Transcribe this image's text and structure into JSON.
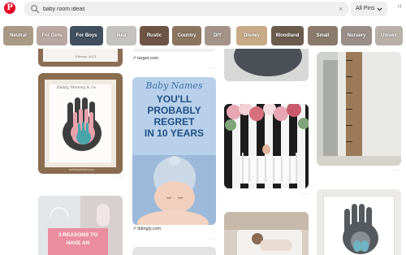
{
  "header": {
    "logo_letter": "P",
    "search_value": "baby room ideas",
    "search_placeholder": "Search",
    "clear_symbol": "×",
    "filter_label": "All Pins",
    "right_label": "H"
  },
  "guides": [
    {
      "label": "Neutral",
      "color": "#a99a86"
    },
    {
      "label": "For Girls",
      "color": "#b9a7a2"
    },
    {
      "label": "For Boys",
      "color": "#41505f"
    },
    {
      "label": "Ikea",
      "color": "#c4c2c0"
    },
    {
      "label": "Rustic",
      "color": "#6e5444"
    },
    {
      "label": "Country",
      "color": "#8b755e"
    },
    {
      "label": "DIY",
      "color": "#a49389"
    },
    {
      "label": "Disney",
      "color": "#c8ab86"
    },
    {
      "label": "Woodland",
      "color": "#6a5b4c"
    },
    {
      "label": "Small",
      "color": "#8a7b6d"
    },
    {
      "label": "Nursery",
      "color": "#9a8f88"
    },
    {
      "label": "Unisex",
      "color": "#b7b1a8"
    }
  ],
  "pins": {
    "frame_top_caption": "Fibrizy 2021",
    "handprint_caption_1": "Daddy, Mommy & Us",
    "handprint_footer": "dutbacketsbit.com",
    "target_source": "target.com",
    "baby_names_script": "Baby Names",
    "baby_names_line1": "YOU'LL",
    "baby_names_line2": "PROBABLY",
    "baby_names_line3": "REGRET",
    "baby_names_line4": "IN 10 YEARS",
    "baby_names_source": "9dingly.com",
    "reasons_line1": "3 REASONS TO",
    "reasons_line2": "HAVE AN",
    "more_symbol": "···"
  }
}
